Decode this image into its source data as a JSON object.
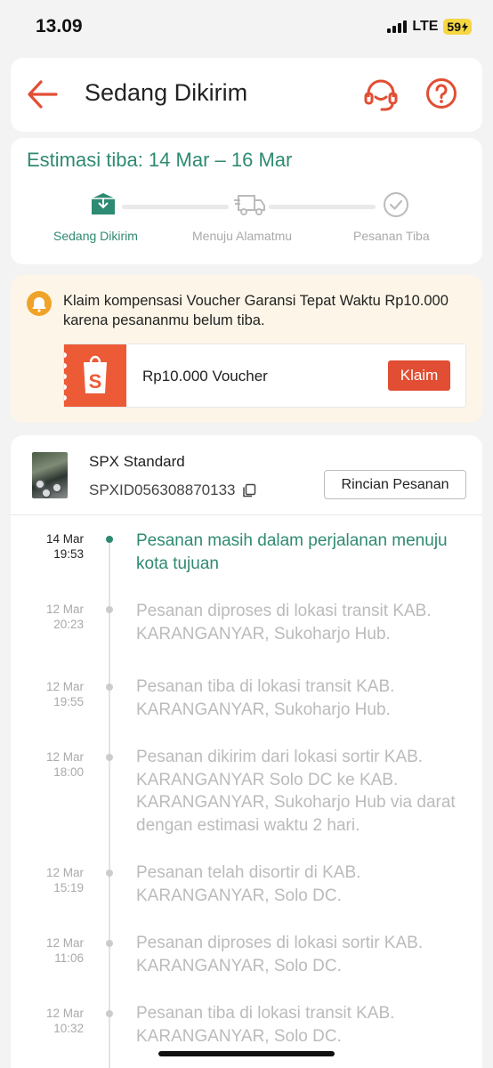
{
  "status_bar": {
    "time": "13.09",
    "network": "LTE",
    "battery": "59"
  },
  "header": {
    "title": "Sedang Dikirim"
  },
  "estimate": {
    "title": "Estimasi tiba: 14 Mar – 16 Mar",
    "steps": [
      {
        "label": "Sedang Dikirim",
        "active": true
      },
      {
        "label": "Menuju Alamatmu",
        "active": false
      },
      {
        "label": "Pesanan Tiba",
        "active": false
      }
    ]
  },
  "voucher": {
    "message": "Klaim kompensasi Voucher Garansi Tepat Waktu Rp10.000 karena pesananmu belum tiba.",
    "name": "Rp10.000 Voucher",
    "claim_label": "Klaim"
  },
  "shipment": {
    "courier": "SPX Standard",
    "tracking_number": "SPXID056308870133",
    "details_label": "Rincian Pesanan"
  },
  "timeline": [
    {
      "date": "14 Mar",
      "time": "19:53",
      "text": "Pesanan masih dalam perjalanan menuju kota tujuan",
      "active": true
    },
    {
      "date": "12 Mar",
      "time": "20:23",
      "text": "Pesanan diproses di lokasi transit KAB. KARANGANYAR, Sukoharjo Hub.",
      "active": false
    },
    {
      "date": "12 Mar",
      "time": "19:55",
      "text": "Pesanan tiba di lokasi transit KAB. KARANGANYAR, Sukoharjo Hub.",
      "active": false
    },
    {
      "date": "12 Mar",
      "time": "18:00",
      "text": "Pesanan dikirim dari lokasi sortir KAB. KARANGANYAR  Solo DC ke KAB. KARANGANYAR, Sukoharjo Hub via darat dengan estimasi waktu 2 hari.",
      "active": false
    },
    {
      "date": "12 Mar",
      "time": "15:19",
      "text": "Pesanan telah disortir di KAB. KARANGANYAR, Solo DC.",
      "active": false
    },
    {
      "date": "12 Mar",
      "time": "11:06",
      "text": "Pesanan diproses di lokasi sortir KAB. KARANGANYAR, Solo DC.",
      "active": false
    },
    {
      "date": "12 Mar",
      "time": "10:32",
      "text": "Pesanan tiba di lokasi transit KAB. KARANGANYAR, Solo DC.",
      "active": false
    }
  ],
  "colors": {
    "accent": "#ee4d2d",
    "green": "#2f8a72",
    "voucher_bg": "#fdf6e8"
  },
  "icons": [
    "back-arrow-icon",
    "headset-icon",
    "help-icon",
    "box-icon",
    "truck-icon",
    "check-circle-icon",
    "bell-icon",
    "shopee-bag-icon",
    "copy-icon"
  ]
}
